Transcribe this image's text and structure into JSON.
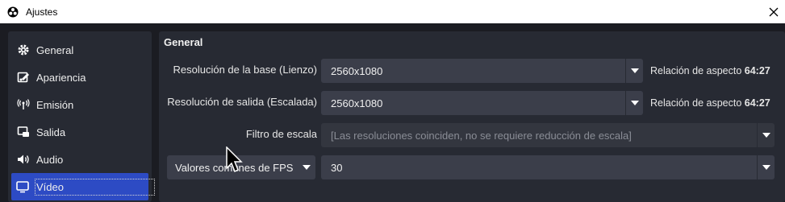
{
  "window": {
    "title": "Ajustes"
  },
  "sidebar": {
    "items": [
      {
        "label": "General",
        "icon": "gear-icon"
      },
      {
        "label": "Apariencia",
        "icon": "palette-icon"
      },
      {
        "label": "Emisión",
        "icon": "broadcast-icon"
      },
      {
        "label": "Salida",
        "icon": "output-icon"
      },
      {
        "label": "Audio",
        "icon": "speaker-icon"
      },
      {
        "label": "Vídeo",
        "icon": "monitor-icon",
        "active": true
      }
    ]
  },
  "panel": {
    "section_title": "General",
    "base_resolution": {
      "label": "Resolución de la base (Lienzo)",
      "value": "2560x1080",
      "aspect_label": "Relación de aspecto",
      "aspect_value": "64:27"
    },
    "output_resolution": {
      "label": "Resolución de salida (Escalada)",
      "value": "2560x1080",
      "aspect_label": "Relación de aspecto",
      "aspect_value": "64:27"
    },
    "scale_filter": {
      "label": "Filtro de escala",
      "value": "[Las resoluciones coinciden, no se requiere reducción de escala]"
    },
    "fps": {
      "type_label": "Valores comunes de FPS",
      "value": "30"
    }
  },
  "colors": {
    "accent": "#2d4bc4",
    "panel_bg": "#272a33",
    "input_bg": "#3b3e4a",
    "window_bg": "#1b1c22"
  }
}
